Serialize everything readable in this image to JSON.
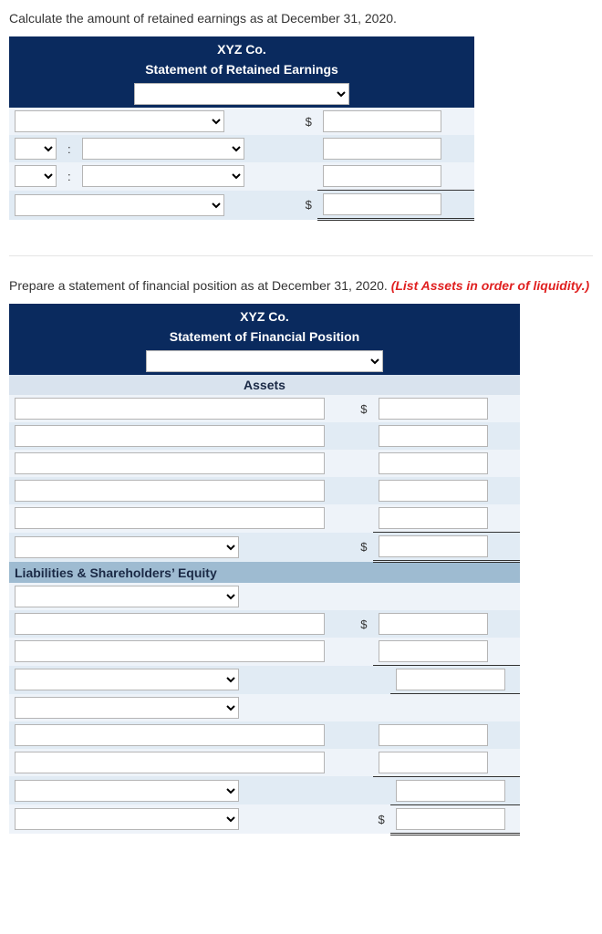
{
  "section1": {
    "instruction": "Calculate the amount of retained earnings as at December 31, 2020.",
    "company": "XYZ Co.",
    "title": "Statement of Retained Earnings",
    "date_select": "",
    "row1": {
      "label": "",
      "amount": ""
    },
    "row2": {
      "sign": "",
      "label": "",
      "amount": ""
    },
    "row3": {
      "sign": "",
      "label": "",
      "amount": ""
    },
    "row4": {
      "label": "",
      "amount": ""
    },
    "dollar": "$",
    "colon": ":"
  },
  "section2": {
    "instruction_plain": "Prepare a statement of financial position as at December 31, 2020. ",
    "instruction_red": "(List Assets in order of liquidity.)",
    "company": "XYZ Co.",
    "title": "Statement of Financial Position",
    "date_select": "",
    "assets_header": "Assets",
    "assets": [
      {
        "label": "",
        "amount": ""
      },
      {
        "label": "",
        "amount": ""
      },
      {
        "label": "",
        "amount": ""
      },
      {
        "label": "",
        "amount": ""
      },
      {
        "label": "",
        "amount": ""
      }
    ],
    "assets_total": {
      "label": "",
      "amount": ""
    },
    "le_header": "Liabilities & Shareholders’ Equity",
    "liab_label": "",
    "liab_rows": [
      {
        "label": "",
        "amount": ""
      },
      {
        "label": "",
        "amount": ""
      }
    ],
    "se_label": "",
    "owners_label": "",
    "se_rows": [
      {
        "label": "",
        "amount": ""
      },
      {
        "label": "",
        "amount": ""
      }
    ],
    "se_subtotal": {
      "label": "",
      "amount": ""
    },
    "total_le": {
      "label": "",
      "amount": ""
    },
    "dollar": "$"
  }
}
